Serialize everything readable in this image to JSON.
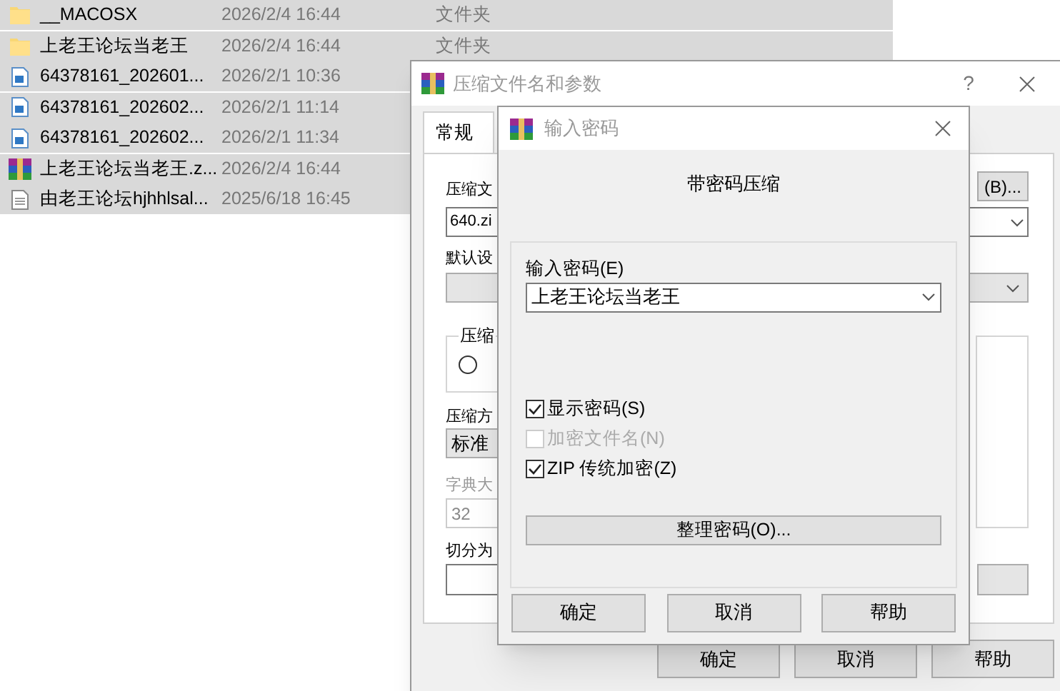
{
  "files": [
    {
      "kind": "folder",
      "name": "__MACOSX",
      "date": "2026/2/4 16:44",
      "type": "文件夹",
      "selected": true
    },
    {
      "kind": "folder",
      "name": "上老王论坛当老王",
      "date": "2026/2/4 16:44",
      "type": "文件夹",
      "selected": true
    },
    {
      "kind": "image",
      "name": "64378161_202601...",
      "date": "2026/2/1 10:36",
      "selected": true
    },
    {
      "kind": "image",
      "name": "64378161_202602...",
      "date": "2026/2/1 11:14",
      "selected": true
    },
    {
      "kind": "image",
      "name": "64378161_202602...",
      "date": "2026/2/1 11:34",
      "selected": true
    },
    {
      "kind": "archive",
      "name": "上老王论坛当老王.z...",
      "date": "2026/2/4 16:44",
      "selected": true
    },
    {
      "kind": "text",
      "name": "由老王论坛hjhhlsal...",
      "date": "2025/6/18 16:45",
      "selected": true
    }
  ],
  "archive_dialog": {
    "title": "压缩文件名和参数",
    "help_button": "?",
    "tabs": [
      {
        "label": "常规",
        "selected": true
      }
    ],
    "archive_name_label": "压缩文",
    "browse_button": "(B)...",
    "archive_name": "640.zi",
    "profile_label": "默认设",
    "format_group": "压缩",
    "format_options": [
      {
        "selected": false
      }
    ],
    "method_label": "压缩方",
    "method": "标准",
    "dictionary_label": "字典大",
    "dictionary": "32",
    "split_label": "切分为",
    "buttons": [
      "确定",
      "取消",
      "帮助"
    ]
  },
  "password_dialog": {
    "title": "输入密码",
    "heading": "带密码压缩",
    "password_label": "输入密码(E)",
    "password": "上老王论坛当老王",
    "options": [
      {
        "label": "显示密码(S)",
        "checked": true,
        "disabled": false
      },
      {
        "label": "加密文件名(N)",
        "checked": false,
        "disabled": true
      },
      {
        "label": "ZIP 传统加密(Z)",
        "checked": true,
        "disabled": false
      }
    ],
    "organize_button": "整理密码(O)...",
    "buttons": [
      "确定",
      "取消",
      "帮助"
    ]
  }
}
